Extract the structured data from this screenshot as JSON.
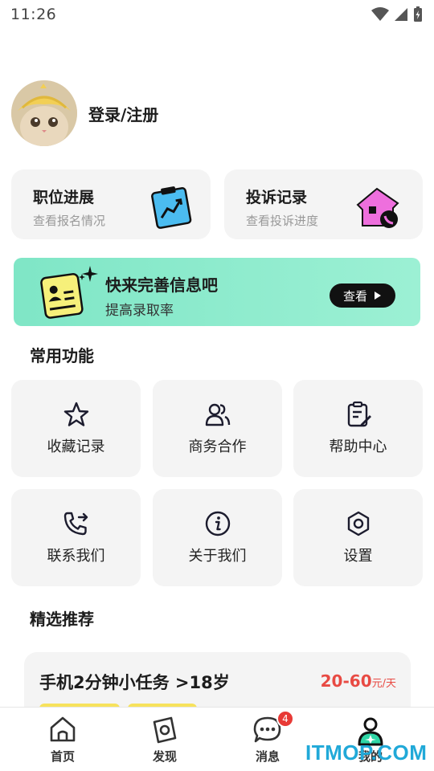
{
  "status": {
    "time": "11:26"
  },
  "profile": {
    "login_label": "登录/注册"
  },
  "cards": [
    {
      "title": "职位进展",
      "subtitle": "查看报名情况"
    },
    {
      "title": "投诉记录",
      "subtitle": "查看投诉进度"
    }
  ],
  "banner": {
    "title": "快来完善信息吧",
    "subtitle": "提高录取率",
    "button_label": "查看"
  },
  "sections": {
    "common": "常用功能",
    "featured": "精选推荐"
  },
  "functions": [
    {
      "label": "收藏记录",
      "icon": "star-icon"
    },
    {
      "label": "商务合作",
      "icon": "users-icon"
    },
    {
      "label": "帮助中心",
      "icon": "clipboard-edit-icon"
    },
    {
      "label": "联系我们",
      "icon": "phone-forward-icon"
    },
    {
      "label": "关于我们",
      "icon": "info-icon"
    },
    {
      "label": "设置",
      "icon": "hexagon-settings-icon"
    }
  ],
  "recommend": [
    {
      "title": "手机2分钟小任务 >18岁",
      "price": "20-60",
      "unit": "元/天"
    }
  ],
  "tabs": [
    {
      "label": "首页",
      "icon": "home-icon"
    },
    {
      "label": "发现",
      "icon": "discover-icon"
    },
    {
      "label": "消息",
      "icon": "message-icon",
      "badge": "4"
    },
    {
      "label": "我的",
      "icon": "profile-icon"
    }
  ],
  "watermark": "ITMOP.COM",
  "colors": {
    "accent_green": "#7fe6c6",
    "price_red": "#e84a43",
    "badge_red": "#e83a36",
    "tag_yellow": "#f7e25c"
  }
}
